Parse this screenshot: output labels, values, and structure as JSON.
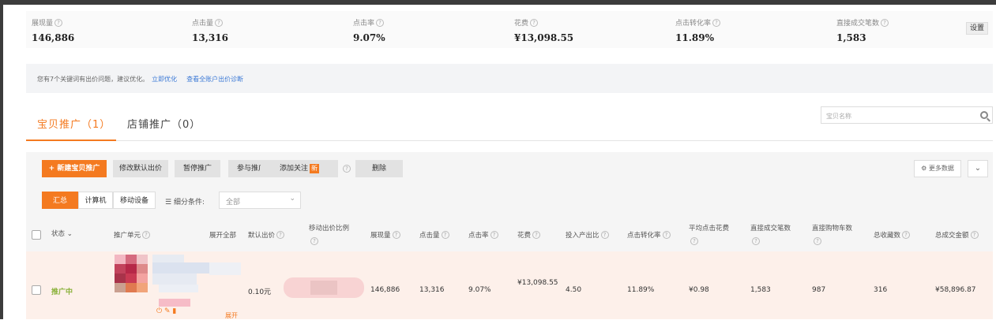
{
  "stats": [
    {
      "label": "展现量",
      "value": "146,886"
    },
    {
      "label": "点击量",
      "value": "13,316"
    },
    {
      "label": "点击率",
      "value": "9.07%"
    },
    {
      "label": "花费",
      "value": "¥13,098.55"
    },
    {
      "label": "点击转化率",
      "value": "11.89%"
    },
    {
      "label": "直接成交笔数",
      "value": "1,583"
    }
  ],
  "settings_label": "设置",
  "notice": {
    "text": "您有7个关键词有出价问题，建议优化。",
    "link1": "立即优化",
    "link2": "查看全账户出价诊断"
  },
  "tabs": [
    {
      "label": "宝贝推广（1）",
      "active": true
    },
    {
      "label": "店铺推广（0）",
      "active": false
    }
  ],
  "search": {
    "placeholder": "宝贝名称"
  },
  "toolbar": {
    "new_label": "+ 新建宝贝推广",
    "modify_bid": "修改默认出价",
    "pause": "暂停推广",
    "join": "参与推广",
    "follow": "添加关注",
    "new_badge": "新",
    "delete": "删除",
    "more_data": "更多数据"
  },
  "segments": [
    "汇总",
    "计算机",
    "移动设备"
  ],
  "filter": {
    "label": "细分条件:",
    "value": "全部"
  },
  "columns": {
    "status": "状态",
    "unit": "推广单元",
    "expand_all": "展开全部",
    "default_bid": "默认出价",
    "mobile_ratio": "移动出价比例",
    "impressions": "展现量",
    "clicks": "点击量",
    "ctr": "点击率",
    "cost": "花费",
    "roi": "投入产出比",
    "cvr": "点击转化率",
    "cpc": "平均点击花费",
    "direct_orders": "直接成交笔数",
    "direct_cart": "直接购物车数",
    "favorites": "总收藏数",
    "gmv": "总成交金额"
  },
  "row": {
    "status": "推广中",
    "default_bid": "0.10元",
    "impressions": "146,886",
    "clicks": "13,316",
    "ctr": "9.07%",
    "cost": "¥13,098.55",
    "roi": "4.50",
    "cvr": "11.89%",
    "cpc": "¥0.98",
    "direct_orders": "1,583",
    "direct_cart": "987",
    "favorites": "316",
    "gmv": "¥58,896.87",
    "expand": "展开"
  },
  "colors": {
    "accent": "#f47a20",
    "link": "#3d7ad6",
    "status_on": "#8ab13a",
    "row_bg": "#fdf0ea"
  }
}
